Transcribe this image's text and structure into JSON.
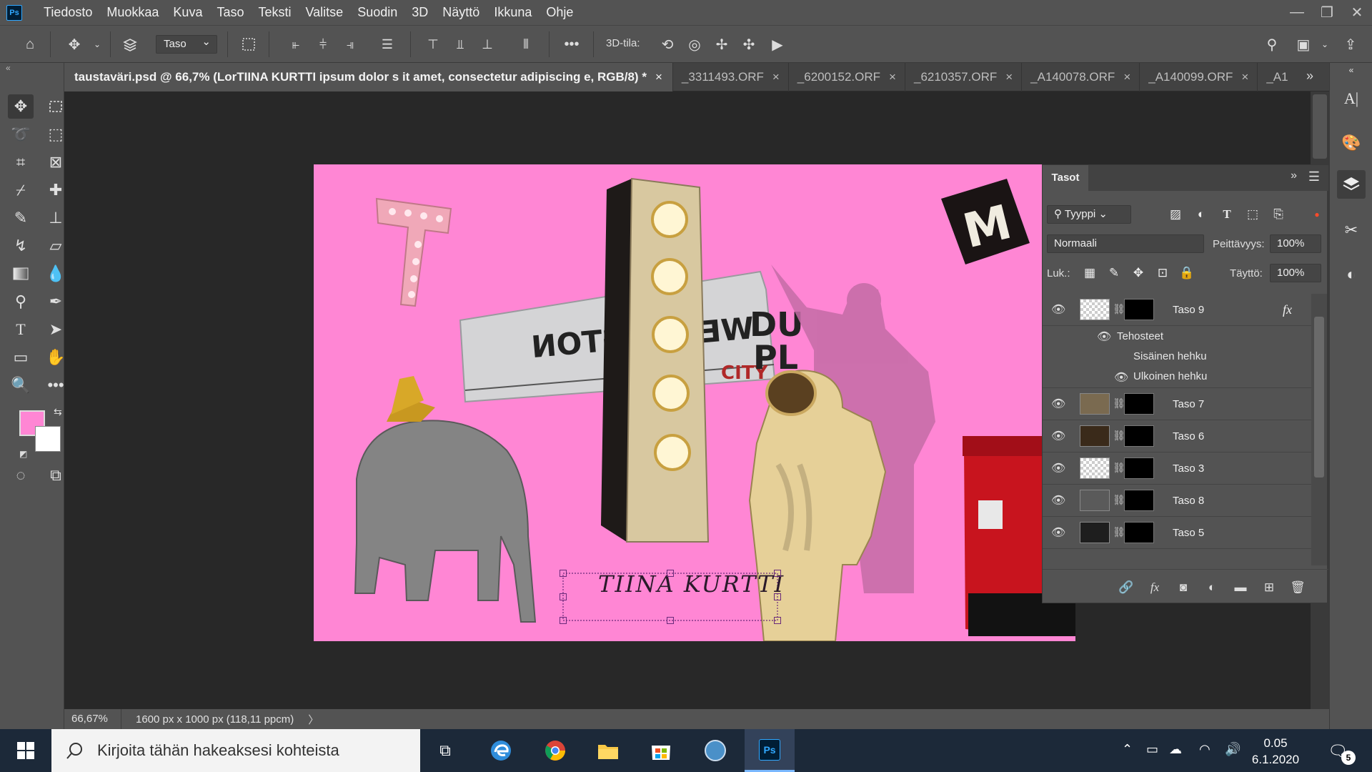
{
  "app": {
    "logo": "Ps",
    "name": "Adobe Photoshop"
  },
  "menu": [
    "Tiedosto",
    "Muokkaa",
    "Kuva",
    "Taso",
    "Teksti",
    "Valitse",
    "Suodin",
    "3D",
    "Näyttö",
    "Ikkuna",
    "Ohje"
  ],
  "window_controls": {
    "minimize": "—",
    "restore": "❐",
    "close": "✕"
  },
  "options": {
    "layer_select": "Taso",
    "label_3d": "3D-tila:"
  },
  "tabs": [
    {
      "label": "taustaväri.psd @ 66,7% (LorTIINA KURTTI ipsum dolor s it amet, consectetur adipiscing e, RGB/8) *",
      "close": "×"
    },
    {
      "label": "_3311493.ORF",
      "close": "×"
    },
    {
      "label": "_6200152.ORF",
      "close": "×"
    },
    {
      "label": "_6210357.ORF",
      "close": "×"
    },
    {
      "label": "_A140078.ORF",
      "close": "×"
    },
    {
      "label": "_A140099.ORF",
      "close": "×"
    },
    {
      "label": "_A1",
      "close": ""
    }
  ],
  "canvas": {
    "background": "#ff86d4",
    "text_layer": "TIINA KURTTI",
    "sign_text_1": "WELLINGTON",
    "sign_text_2": "DU",
    "sign_text_3": "PL",
    "sign_text_4": "CITY",
    "sign_text_5": "M",
    "letter_t": "T"
  },
  "status": {
    "zoom": "66,67%",
    "doc_size": "1600 px x 1000 px (118,11 ppcm)",
    "arrow": "〉"
  },
  "colors": {
    "foreground": "#ff86d4",
    "background": "#ffffff"
  },
  "layers_panel": {
    "title": "Tasot",
    "filter_type": "Tyyppi",
    "blend_mode": "Normaali",
    "opacity_label": "Peittävyys:",
    "opacity_value": "100%",
    "lock_label": "Luk.:",
    "fill_label": "Täyttö:",
    "fill_value": "100%",
    "layers": [
      {
        "name": "Taso 9",
        "fx": "fx"
      },
      {
        "name": "Taso 7"
      },
      {
        "name": "Taso 6"
      },
      {
        "name": "Taso 3"
      },
      {
        "name": "Taso 8"
      },
      {
        "name": "Taso 5"
      }
    ],
    "effects_header": "Tehosteet",
    "effect_inner": "Sisäinen hehku",
    "effect_outer": "Ulkoinen hehku"
  },
  "taskbar": {
    "search_placeholder": "Kirjoita tähän hakeaksesi kohteista",
    "time": "0.05",
    "date": "6.1.2020",
    "notifications": "5"
  }
}
